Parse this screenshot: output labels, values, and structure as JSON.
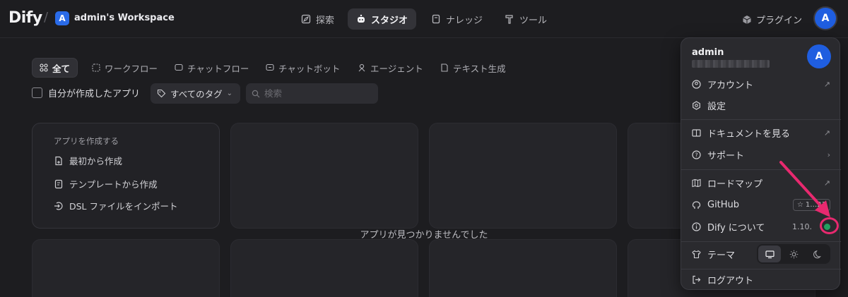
{
  "header": {
    "logo": "Dify",
    "separator": "/",
    "workspace_initial": "A",
    "workspace_name": "admin's Workspace",
    "nav": [
      {
        "label": "探索",
        "icon": "compass-icon"
      },
      {
        "label": "スタジオ",
        "icon": "robot-icon",
        "active": true
      },
      {
        "label": "ナレッジ",
        "icon": "book-icon"
      },
      {
        "label": "ツール",
        "icon": "hammer-icon"
      }
    ],
    "plugins_label": "プラグイン",
    "avatar_initial": "A"
  },
  "filters": {
    "tabs": [
      {
        "label": "全て",
        "active": true
      },
      {
        "label": "ワークフロー"
      },
      {
        "label": "チャットフロー"
      },
      {
        "label": "チャットボット"
      },
      {
        "label": "エージェント"
      },
      {
        "label": "テキスト生成"
      }
    ],
    "my_apps_label": "自分が作成したアプリ",
    "tags_label": "すべてのタグ",
    "search_placeholder": "検索"
  },
  "create_card": {
    "title": "アプリを作成する",
    "items": [
      "最初から作成",
      "テンプレートから作成",
      "DSL ファイルをインポート"
    ]
  },
  "empty_message": "アプリが見つかりませんでした",
  "account_menu": {
    "name": "admin",
    "avatar_initial": "A",
    "items": {
      "account": "アカウント",
      "settings": "設定",
      "docs": "ドキュメントを見る",
      "support": "サポート",
      "roadmap": "ロードマップ",
      "github": "GitHub",
      "github_stars": "1…21",
      "about": "Dify について",
      "version": "1.10.",
      "theme": "テーマ",
      "logout": "ログアウト"
    },
    "theme_options": [
      "system",
      "light",
      "dark"
    ],
    "theme_selected": "system"
  },
  "colors": {
    "accent": "#1f5ee0",
    "status_ok": "#22a060",
    "annotation": "#e8296f",
    "background": "#1d1d20",
    "menu_bg": "#2a2a2e"
  }
}
